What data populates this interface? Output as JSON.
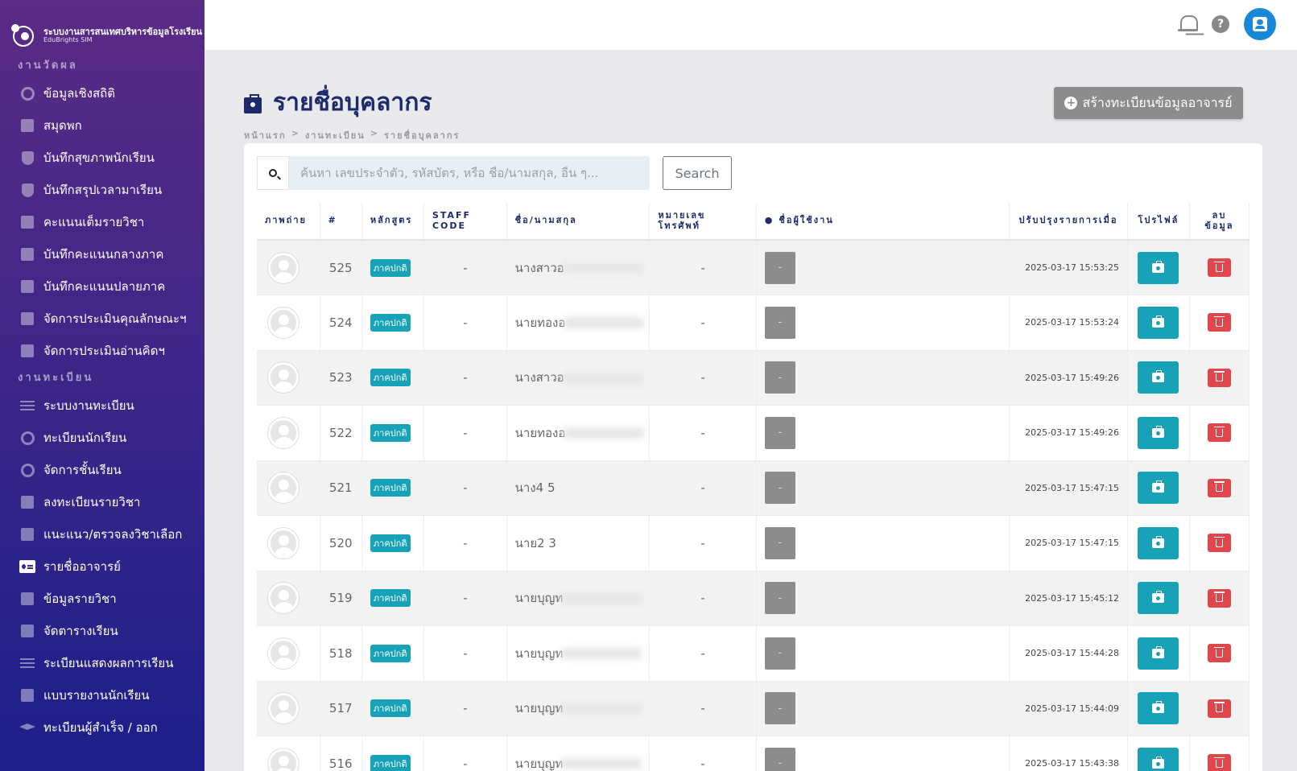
{
  "brand": {
    "title": "ระบบงานสารสนเทศบริหารข้อมูลโรงเรียน",
    "subtitle": "EduBrights SIM"
  },
  "sidebar": {
    "sections": [
      {
        "title": "งานวัดผล",
        "items": [
          {
            "label": "ข้อมูลเชิงสถิติ",
            "icon": "pie-chart-icon"
          },
          {
            "label": "สมุดพก",
            "icon": "book-icon"
          },
          {
            "label": "บันทึกสุขภาพนักเรียน",
            "icon": "shield-icon"
          },
          {
            "label": "บันทึกสรุปเวลามาเรียน",
            "icon": "shield-icon"
          },
          {
            "label": "คะแนนเต็มรายวิชา",
            "icon": "book-icon"
          },
          {
            "label": "บันทึกคะแนนกลางภาค",
            "icon": "book-icon"
          },
          {
            "label": "บันทึกคะแนนปลายภาค",
            "icon": "book-icon"
          },
          {
            "label": "จัดการประเมินคุณลักษณะฯ",
            "icon": "book-icon"
          },
          {
            "label": "จัดการประเมินอ่านคิดฯ",
            "icon": "book-icon"
          }
        ]
      },
      {
        "title": "งานทะเบียน",
        "items": [
          {
            "label": "ระบบงานทะเบียน",
            "icon": "list-icon"
          },
          {
            "label": "ทะเบียนนักเรียน",
            "icon": "student-icon"
          },
          {
            "label": "จัดการชั้นเรียน",
            "icon": "user-circle-icon"
          },
          {
            "label": "ลงทะเบียนรายวิชา",
            "icon": "register-icon"
          },
          {
            "label": "แนะแนว/ตรวจลงวิชาเลือก",
            "icon": "plus-square-icon"
          },
          {
            "label": "รายชื่ออาจารย์",
            "icon": "id-card-icon",
            "active": true
          },
          {
            "label": "ข้อมูลรายวิชา",
            "icon": "book-open-icon"
          },
          {
            "label": "จัดตารางเรียน",
            "icon": "calendar-icon"
          },
          {
            "label": "ระเบียนแสดงผลการเรียน",
            "icon": "document-icon"
          },
          {
            "label": "แบบรายงานนักเรียน",
            "icon": "print-icon"
          },
          {
            "label": "ทะเบียนผู้สำเร็จ / ออก",
            "icon": "graduation-cap-icon"
          }
        ]
      }
    ]
  },
  "topbar": {
    "icons": [
      "bell-icon",
      "help-icon",
      "user-account-icon"
    ]
  },
  "header": {
    "title": "รายชื่อบุคลากร",
    "breadcrumb": [
      "หน้าแรก",
      "งานทะเบียน",
      "รายชื่อบุคลากร"
    ],
    "create_button": "สร้างทะเบียนข้อมูลอาจารย์"
  },
  "search": {
    "placeholder": "ค้นหา เลขประจำตัว, รหัสบัตร, หรือ ชื่อ/นามสกุล, อื่น ๆ...",
    "button": "Search"
  },
  "table": {
    "columns": [
      "ภาพถ่าย",
      "#",
      "หลักสูตร",
      "STAFF CODE",
      "ชื่อ/นามสกุล",
      "หมายเลข โทรศัพท์",
      "ชื่อผู้ใช้งาน",
      "ปรับปรุงรายการเมื่อ",
      "โปรไฟล์",
      "ลบ ข้อมูล"
    ],
    "rows": [
      {
        "id": "525",
        "course": "ภาคปกติ",
        "staff_code": "-",
        "name": "นางสาวอ",
        "phone": "-",
        "username": "-",
        "updated": "2025-03-17 15:53:25"
      },
      {
        "id": "524",
        "course": "ภาคปกติ",
        "staff_code": "-",
        "name": "นายทองอ",
        "phone": "-",
        "username": "-",
        "updated": "2025-03-17 15:53:24"
      },
      {
        "id": "523",
        "course": "ภาคปกติ",
        "staff_code": "-",
        "name": "นางสาวอ",
        "phone": "-",
        "username": "-",
        "updated": "2025-03-17 15:49:26"
      },
      {
        "id": "522",
        "course": "ภาคปกติ",
        "staff_code": "-",
        "name": "นายทองอ",
        "phone": "-",
        "username": "-",
        "updated": "2025-03-17 15:49:26"
      },
      {
        "id": "521",
        "course": "ภาคปกติ",
        "staff_code": "-",
        "name": "นาง4 5",
        "phone": "-",
        "username": "-",
        "updated": "2025-03-17 15:47:15"
      },
      {
        "id": "520",
        "course": "ภาคปกติ",
        "staff_code": "-",
        "name": "นาย2 3",
        "phone": "-",
        "username": "-",
        "updated": "2025-03-17 15:47:15"
      },
      {
        "id": "519",
        "course": "ภาคปกติ",
        "staff_code": "-",
        "name": "นายบุญท",
        "phone": "-",
        "username": "-",
        "updated": "2025-03-17 15:45:12"
      },
      {
        "id": "518",
        "course": "ภาคปกติ",
        "staff_code": "-",
        "name": "นายบุญท",
        "phone": "-",
        "username": "-",
        "updated": "2025-03-17 15:44:28"
      },
      {
        "id": "517",
        "course": "ภาคปกติ",
        "staff_code": "-",
        "name": "นายบุญท",
        "phone": "-",
        "username": "-",
        "updated": "2025-03-17 15:44:09"
      },
      {
        "id": "516",
        "course": "ภาคปกติ",
        "staff_code": "-",
        "name": "นายบุญท",
        "phone": "-",
        "username": "-",
        "updated": "2025-03-17 15:43:38"
      }
    ]
  }
}
